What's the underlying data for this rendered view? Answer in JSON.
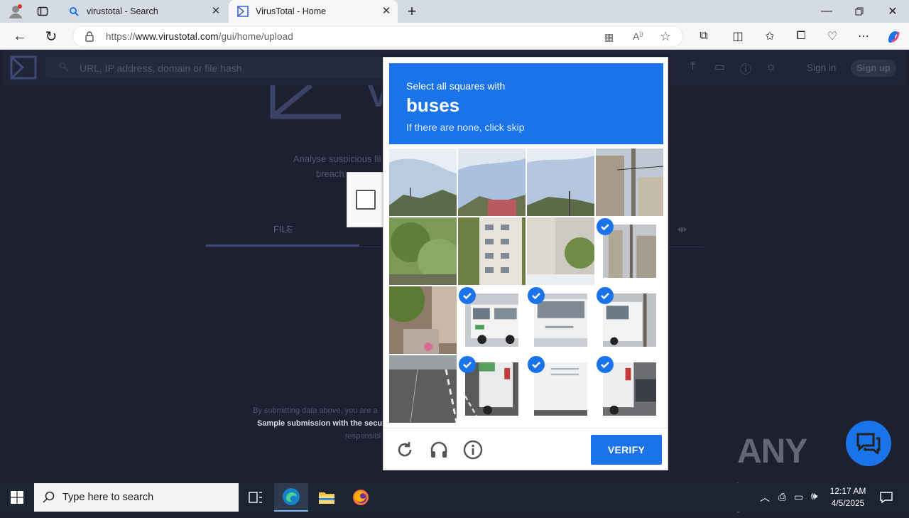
{
  "browser": {
    "tabs": [
      {
        "label": "virustotal - Search",
        "icon": "search-icon",
        "active": false
      },
      {
        "label": "VirusTotal - Home",
        "icon": "virustotal-icon",
        "active": true
      }
    ],
    "url_prefix": "https://",
    "url_host": "www.virustotal.com",
    "url_path": "/gui/home/upload"
  },
  "page": {
    "search_placeholder": "URL, IP address, domain or file hash",
    "sign_in": "Sign in",
    "sign_up": "Sign up",
    "analyse_line1": "Analyse suspicious fil",
    "analyse_line2": "breach",
    "tab_file": "FILE",
    "tos_line1": "By submitting data above, you are a",
    "tos_line2": "Sample submission with the secur",
    "tos_line3": "responsibl"
  },
  "captcha": {
    "instruction": "Select all squares with",
    "target": "buses",
    "subtitle": "If there are none, click skip",
    "verify_label": "VERIFY",
    "accent": "#1a73e8",
    "tiles_selected": [
      false,
      false,
      false,
      false,
      false,
      false,
      false,
      true,
      false,
      true,
      true,
      true,
      false,
      true,
      true,
      true
    ]
  },
  "taskbar": {
    "search_text": "Type here to search",
    "time": "12:17 AM",
    "date": "4/5/2025"
  },
  "watermark": "ANY RUN"
}
